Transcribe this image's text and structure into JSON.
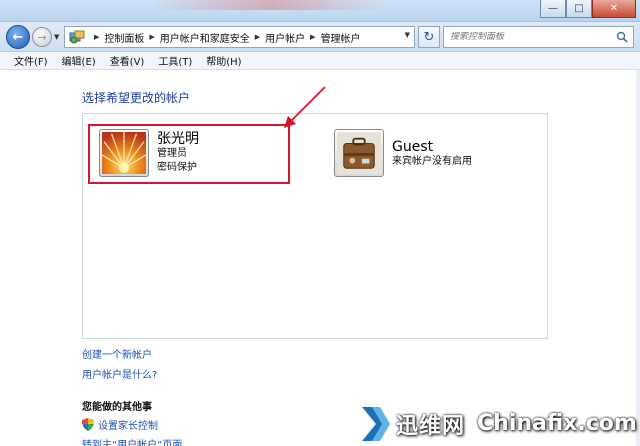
{
  "address": {
    "crumbs": [
      "控制面板",
      "用户帐户和家庭安全",
      "用户帐户",
      "管理帐户"
    ]
  },
  "search": {
    "placeholder": "搜索控制面板"
  },
  "menu": [
    "文件(F)",
    "编辑(E)",
    "查看(V)",
    "工具(T)",
    "帮助(H)"
  ],
  "main": {
    "heading": "选择希望更改的帐户",
    "accounts": [
      {
        "name": "张光明",
        "line1": "管理员",
        "line2": "密码保护",
        "icon": "orange-flower-avatar-icon"
      },
      {
        "name": "Guest",
        "line1": "来宾帐户没有启用",
        "line2": "",
        "icon": "guest-suitcase-avatar-icon"
      }
    ],
    "links": [
      "创建一个新帐户",
      "用户帐户是什么?"
    ],
    "other_title": "您能做的其他事",
    "other_items": [
      "设置家长控制"
    ],
    "cut_text": "转到主“用户帐户”页面"
  },
  "watermark": {
    "cn": "迅维网",
    "en": "Chinafix.com"
  },
  "colors": {
    "highlight": "#d6162a",
    "link": "#1c4fb3",
    "heading": "#1e3d9e"
  }
}
